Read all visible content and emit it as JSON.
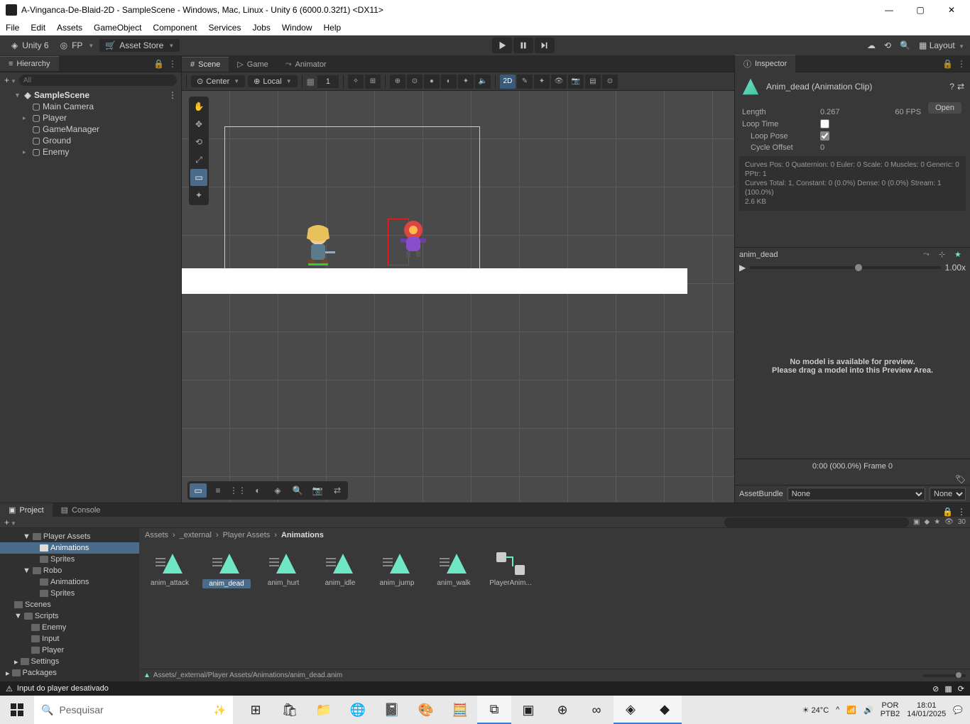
{
  "window": {
    "title": "A-Vinganca-De-Blaid-2D - SampleScene - Windows, Mac, Linux - Unity 6 (6000.0.32f1) <DX11>"
  },
  "menu": [
    "File",
    "Edit",
    "Assets",
    "GameObject",
    "Component",
    "Services",
    "Jobs",
    "Window",
    "Help"
  ],
  "toolbar": {
    "unity_label": "Unity 6",
    "user": "FP",
    "asset_store": "Asset Store",
    "layout": "Layout"
  },
  "hierarchy": {
    "title": "Hierarchy",
    "search_placeholder": "All",
    "scene": "SampleScene",
    "items": [
      "Main Camera",
      "Player",
      "GameManager",
      "Ground",
      "Enemy"
    ]
  },
  "scene_tabs": {
    "scene": "Scene",
    "game": "Game",
    "animator": "Animator"
  },
  "scene_toolbar": {
    "pivot": "Center",
    "space": "Local",
    "grid_value": "1",
    "mode2d": "2D"
  },
  "inspector": {
    "title": "Inspector",
    "asset_name": "Anim_dead (Animation Clip)",
    "open": "Open",
    "length_label": "Length",
    "length": "0.267",
    "fps": "60 FPS",
    "loop_time": "Loop Time",
    "loop_pose": "Loop Pose",
    "cycle_offset_label": "Cycle Offset",
    "cycle_offset": "0",
    "curves_line1": "Curves Pos: 0 Quaternion: 0 Euler: 0 Scale: 0 Muscles: 0 Generic: 0 PPtr: 1",
    "curves_line2": "Curves Total: 1, Constant: 0 (0.0%) Dense: 0 (0.0%) Stream: 1 (100.0%)",
    "size": "2.6 KB",
    "preview_name": "anim_dead",
    "speed": "1.00x",
    "no_model_1": "No model is available for preview.",
    "no_model_2": "Please drag a model into this Preview Area.",
    "frame_info": "0:00 (000.0%) Frame 0",
    "bundle_label": "AssetBundle",
    "bundle_val": "None",
    "bundle_variant": "None"
  },
  "project": {
    "project_tab": "Project",
    "console_tab": "Console",
    "count": "30",
    "folders": {
      "player_assets": "Player Assets",
      "animations": "Animations",
      "sprites": "Sprites",
      "robo": "Robo",
      "scenes": "Scenes",
      "scripts": "Scripts",
      "enemy": "Enemy",
      "input": "Input",
      "player": "Player",
      "settings": "Settings",
      "packages": "Packages"
    },
    "breadcrumb": [
      "Assets",
      "_external",
      "Player Assets",
      "Animations"
    ],
    "assets": [
      "anim_attack",
      "anim_dead",
      "anim_hurt",
      "anim_idle",
      "anim_jump",
      "anim_walk",
      "PlayerAnim..."
    ],
    "selected_path": "Assets/_external/Player Assets/Animations/anim_dead.anim"
  },
  "statusbar": {
    "msg": "Input do player desativado"
  },
  "taskbar": {
    "search": "Pesquisar",
    "weather": "24°C",
    "lang": "POR",
    "kb": "PTB2",
    "time": "18:01",
    "date": "14/01/2025"
  }
}
